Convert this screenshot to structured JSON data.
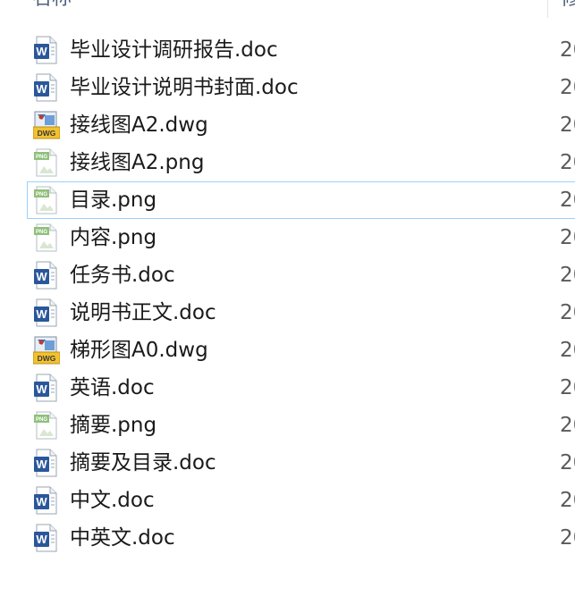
{
  "header": {
    "name_label": "名称",
    "next_label": "修"
  },
  "files": [
    {
      "name": "毕业设计调研报告.doc",
      "type": "doc",
      "date": "20",
      "icon": "word-doc-icon"
    },
    {
      "name": "毕业设计说明书封面.doc",
      "type": "doc",
      "date": "20",
      "icon": "word-doc-icon"
    },
    {
      "name": "接线图A2.dwg",
      "type": "dwg",
      "date": "20",
      "icon": "dwg-file-icon"
    },
    {
      "name": "接线图A2.png",
      "type": "png",
      "date": "20",
      "icon": "png-image-icon"
    },
    {
      "name": "目录.png",
      "type": "png",
      "date": "20",
      "icon": "png-image-icon",
      "selected": true
    },
    {
      "name": "内容.png",
      "type": "png",
      "date": "20",
      "icon": "png-image-icon"
    },
    {
      "name": "任务书.doc",
      "type": "doc",
      "date": "20",
      "icon": "word-doc-icon"
    },
    {
      "name": "说明书正文.doc",
      "type": "doc",
      "date": "20",
      "icon": "word-doc-icon"
    },
    {
      "name": "梯形图A0.dwg",
      "type": "dwg",
      "date": "20",
      "icon": "dwg-file-icon"
    },
    {
      "name": "英语.doc",
      "type": "doc",
      "date": "20",
      "icon": "word-doc-icon"
    },
    {
      "name": "摘要.png",
      "type": "png",
      "date": "20",
      "icon": "png-image-icon"
    },
    {
      "name": "摘要及目录.doc",
      "type": "doc",
      "date": "20",
      "icon": "word-doc-icon"
    },
    {
      "name": "中文.doc",
      "type": "doc",
      "date": "20",
      "icon": "word-doc-icon"
    },
    {
      "name": "中英文.doc",
      "type": "doc",
      "date": "20",
      "icon": "word-doc-icon"
    }
  ],
  "icon_labels": {
    "doc": "W",
    "dwg": "DWG",
    "png": "PNG"
  },
  "colors": {
    "selection_border": "#99d1ff",
    "word_blue": "#2b579a",
    "dwg_yellow": "#f2c12e",
    "png_green": "#8fbf7a"
  }
}
